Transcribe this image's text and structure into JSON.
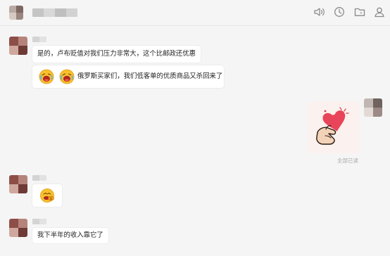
{
  "messages": [
    {
      "text": "是的，卢布贬值对我们压力非常大，这个比邮政还优惠"
    },
    {
      "text": "俄罗斯买家们，我们低客单的优质商品又杀回来了"
    },
    {
      "text": "我下半年的收入靠它了"
    }
  ],
  "read_status": "全部已读",
  "icons": {
    "toolbar": [
      "speaker-icon",
      "history-icon",
      "folder-icon",
      "user-icon"
    ],
    "emoji": [
      "laughing-crying-emoji-icon",
      "laughing-crying-emoji-icon",
      "greedy-money-emoji-icon"
    ],
    "sticker": "finger-heart-sticker-icon"
  },
  "colors": {
    "background": "#f5f5f5",
    "bubble": "#ffffff",
    "icon_gray": "#8a8a8a",
    "read_status": "#a8a8a8"
  }
}
